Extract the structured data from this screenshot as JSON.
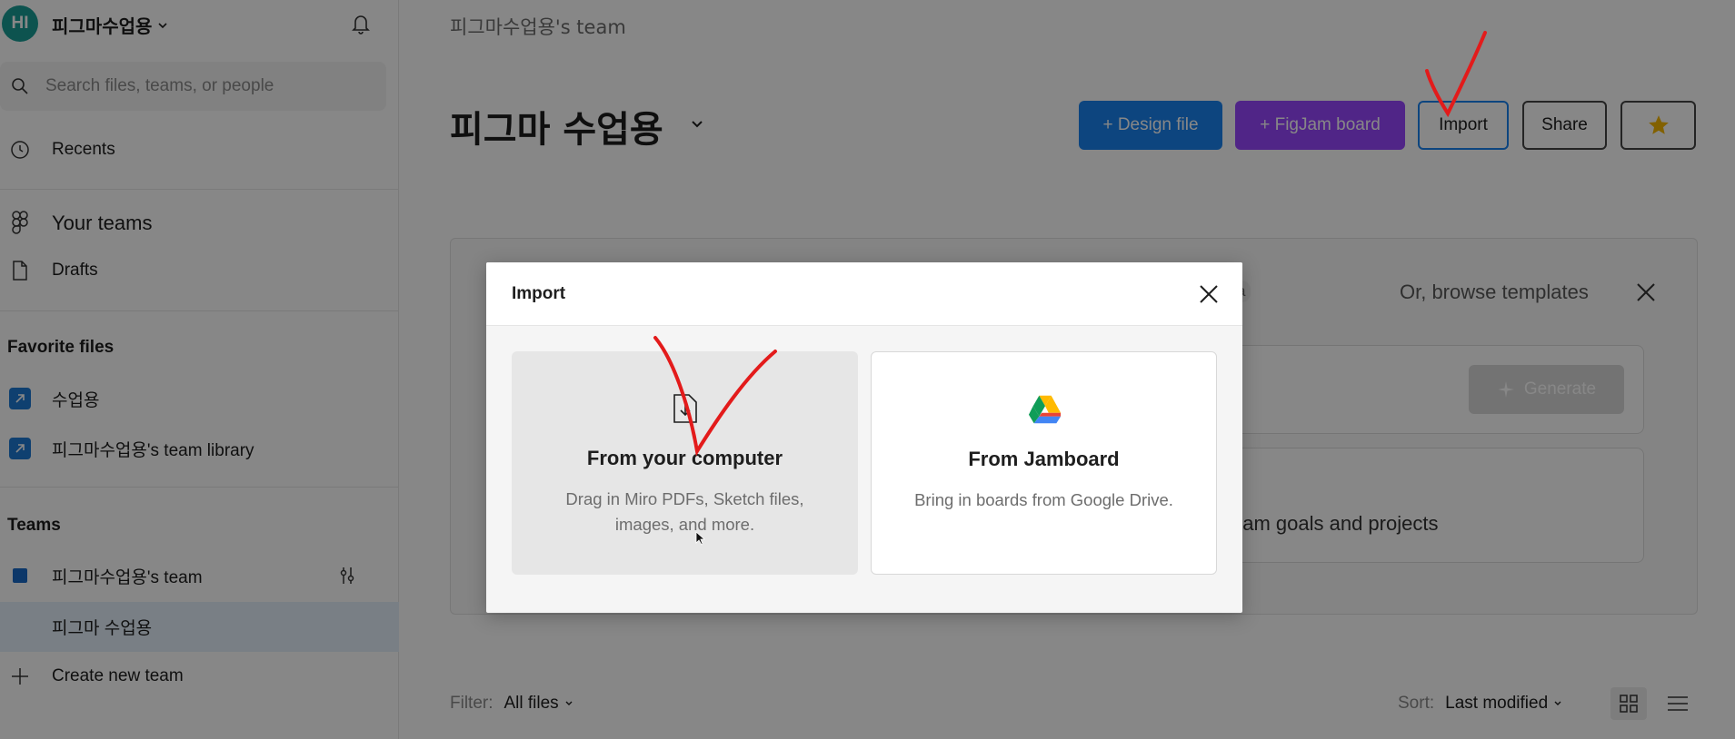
{
  "sidebar": {
    "avatar_initials": "HI",
    "workspace_name": "피그마수업용",
    "search_placeholder": "Search files, teams, or people",
    "recents_label": "Recents",
    "your_teams_label": "Your teams",
    "drafts_label": "Drafts",
    "favorite_files_title": "Favorite files",
    "favorites": [
      {
        "label": "수업용"
      },
      {
        "label": "피그마수업용's team library"
      }
    ],
    "teams_title": "Teams",
    "teams": [
      {
        "label": "피그마수업용's team"
      },
      {
        "label": "피그마 수업용"
      }
    ],
    "create_team_label": "Create new team"
  },
  "main": {
    "team_crumb": "피그마수업용's team",
    "page_title": "피그마 수업용",
    "buttons": {
      "design_file": "+ Design file",
      "figjam_board": "+ FigJam board",
      "import": "Import",
      "share": "Share"
    },
    "browse_templates": "Or, browse templates",
    "badge_partial": "a",
    "generate_label": "Generate",
    "goals_text": "eam goals and projects",
    "filter_label": "Filter:",
    "filter_value": "All files",
    "sort_label": "Sort:",
    "sort_value": "Last modified"
  },
  "modal": {
    "title": "Import",
    "options": [
      {
        "title": "From your computer",
        "description": "Drag in Miro PDFs, Sketch files, images, and more."
      },
      {
        "title": "From Jamboard",
        "description": "Bring in boards from Google Drive."
      }
    ]
  },
  "colors": {
    "primary_blue": "#1a82f0",
    "figjam_purple": "#9747ff",
    "avatar_teal": "#1a9e96",
    "annotation_red": "#e31b1b",
    "star_yellow": "#f5b700"
  }
}
